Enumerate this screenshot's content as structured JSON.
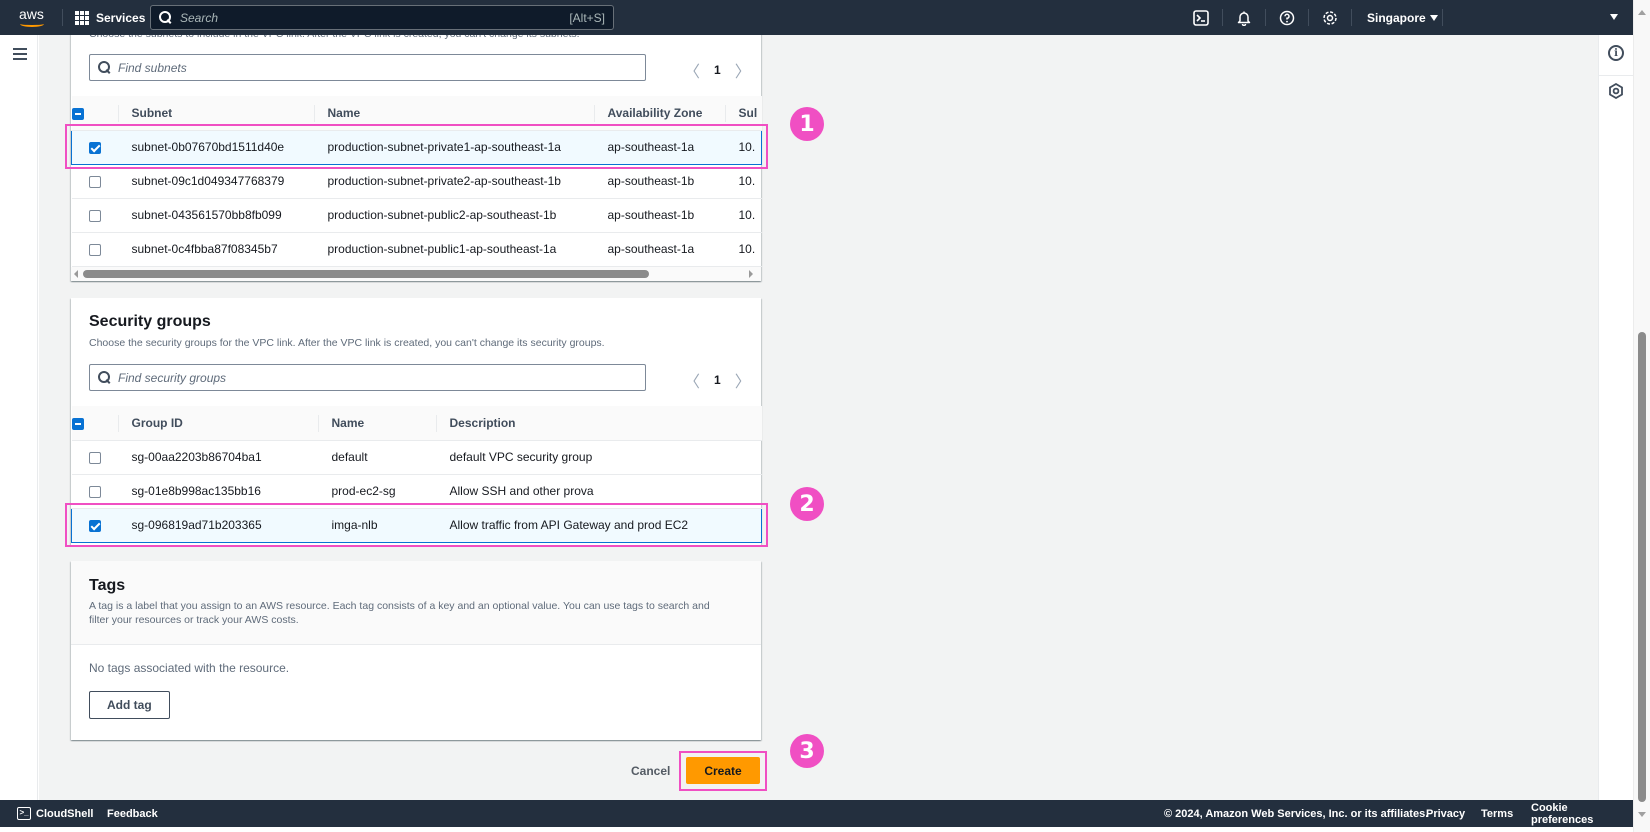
{
  "topnav": {
    "logo": "aws",
    "services_label": "Services",
    "search_placeholder": "Search",
    "search_shortcut": "[Alt+S]",
    "region_label": "Singapore",
    "icons": [
      "cloudshell-icon",
      "notifications-bell-icon",
      "help-icon",
      "settings-gear-icon"
    ]
  },
  "subnets": {
    "cut_description": "Choose the subnets to include in the VPC link. After the VPC link is created, you can't change its subnets.",
    "search_placeholder": "Find subnets",
    "page": "1",
    "columns": [
      "Subnet",
      "Name",
      "Availability Zone",
      "Sul"
    ],
    "rows": [
      {
        "subnet": "subnet-0b07670bd1511d40e",
        "name": "production-subnet-private1-ap-southeast-1a",
        "az": "ap-southeast-1a",
        "cidr": "10.",
        "selected": true
      },
      {
        "subnet": "subnet-09c1d049347768379",
        "name": "production-subnet-private2-ap-southeast-1b",
        "az": "ap-southeast-1b",
        "cidr": "10.",
        "selected": false
      },
      {
        "subnet": "subnet-043561570bb8fb099",
        "name": "production-subnet-public2-ap-southeast-1b",
        "az": "ap-southeast-1b",
        "cidr": "10.",
        "selected": false
      },
      {
        "subnet": "subnet-0c4fbba87f08345b7",
        "name": "production-subnet-public1-ap-southeast-1a",
        "az": "ap-southeast-1a",
        "cidr": "10.",
        "selected": false
      }
    ]
  },
  "security_groups": {
    "title": "Security groups",
    "description": "Choose the security groups for the VPC link. After the VPC link is created, you can't change its security groups.",
    "search_placeholder": "Find security groups",
    "page": "1",
    "columns": [
      "Group ID",
      "Name",
      "Description"
    ],
    "rows": [
      {
        "group_id": "sg-00aa2203b86704ba1",
        "name": "default",
        "description": "default VPC security group",
        "selected": false
      },
      {
        "group_id": "sg-01e8b998ac135bb16",
        "name": "prod-ec2-sg",
        "description": "Allow SSH and other prova",
        "selected": false
      },
      {
        "group_id": "sg-096819ad71b203365",
        "name": "imga-nlb",
        "description": "Allow traffic from API Gateway and prod EC2",
        "selected": true
      }
    ]
  },
  "tags": {
    "title": "Tags",
    "description": "A tag is a label that you assign to an AWS resource. Each tag consists of a key and an optional value. You can use tags to search and filter your resources or track your AWS costs.",
    "empty_text": "No tags associated with the resource.",
    "add_tag_label": "Add tag"
  },
  "actions": {
    "cancel_label": "Cancel",
    "create_label": "Create"
  },
  "annotations": {
    "badge1": "1",
    "badge2": "2",
    "badge3": "3",
    "color": "#f04fc3"
  },
  "footer": {
    "cloudshell_label": "CloudShell",
    "feedback_label": "Feedback",
    "copyright": "© 2024, Amazon Web Services, Inc. or its affiliates.",
    "privacy_label": "Privacy",
    "terms_label": "Terms",
    "cookie_label": "Cookie preferences"
  },
  "colors": {
    "nav_bg": "#232f3e",
    "primary_button": "#ff9900",
    "selection_blue": "#0972d3"
  }
}
